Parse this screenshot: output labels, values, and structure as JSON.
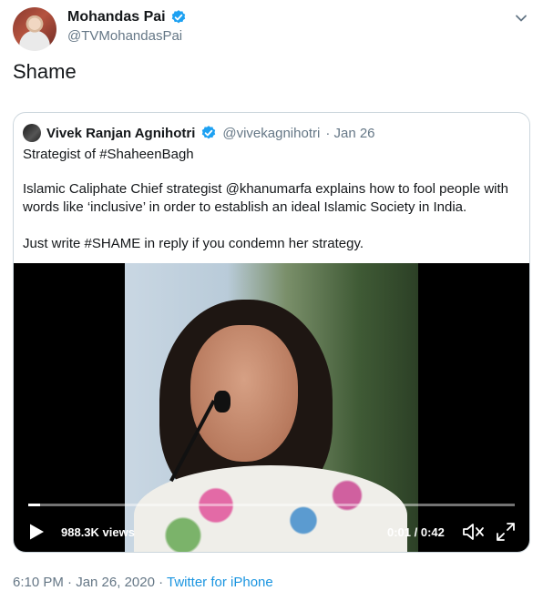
{
  "tweet": {
    "author_name": "Mohandas Pai",
    "author_handle": "@TVMohandasPai",
    "text": "Shame",
    "timestamp": "6:10 PM · Jan 26, 2020",
    "separator": " · ",
    "source": "Twitter for iPhone"
  },
  "quoted": {
    "author_name": "Vivek Ranjan Agnihotri",
    "author_handle": "@vivekagnihotri",
    "date": "· Jan 26",
    "line1": "Strategist of #ShaheenBagh",
    "line2": "Islamic Caliphate Chief strategist @khanumarfa explains how to fool people with words like ‘inclusive’ in order to establish an ideal Islamic Society in India.",
    "line3": "Just write #SHAME  in reply if you condemn her strategy."
  },
  "video": {
    "views": "988.3K views",
    "time": "0:01 / 0:42",
    "progress": 0.024
  },
  "colors": {
    "verified": "#1da1f2",
    "link": "#1b95e0",
    "muted_text": "#657786",
    "border": "#ccd6dd"
  },
  "icons": {
    "verified": "verified-badge-icon",
    "chevron": "chevron-down-icon",
    "play": "play-icon",
    "mute": "volume-muted-icon",
    "fullscreen": "fullscreen-icon"
  }
}
